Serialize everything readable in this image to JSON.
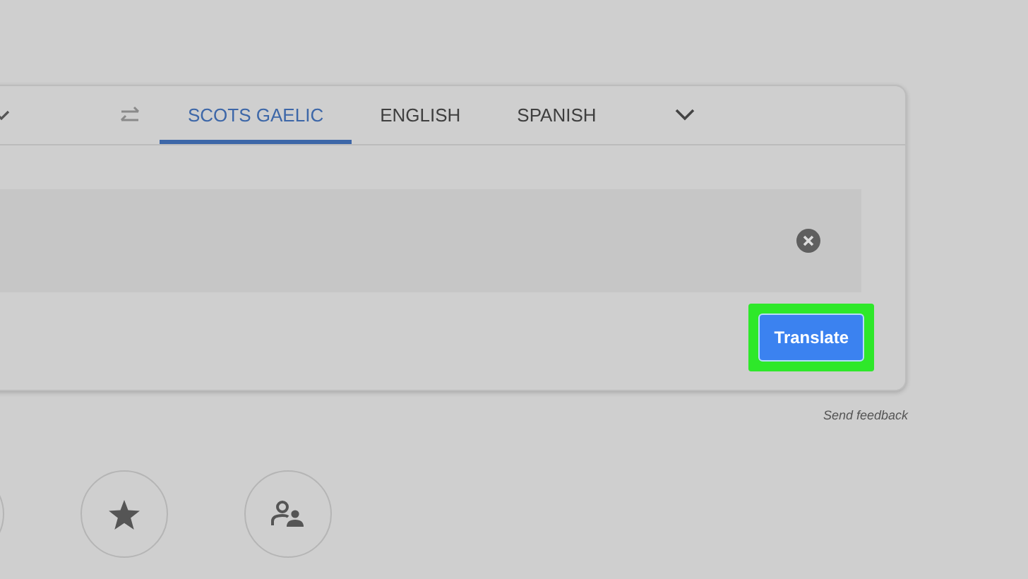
{
  "language_tabs": [
    {
      "label": "SCOTS GAELIC",
      "selected": true
    },
    {
      "label": "ENGLISH",
      "selected": false
    },
    {
      "label": "SPANISH",
      "selected": false
    }
  ],
  "translate_button": {
    "label": "Translate",
    "highlighted": true
  },
  "feedback_link": "Send feedback"
}
